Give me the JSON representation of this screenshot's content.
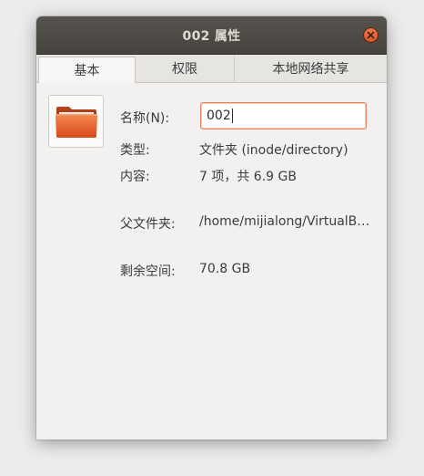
{
  "window": {
    "title": "002 属性",
    "close_icon": "close-icon"
  },
  "tabs": [
    {
      "label": "基本",
      "active": true
    },
    {
      "label": "权限",
      "active": false
    },
    {
      "label": "本地网络共享",
      "active": false
    }
  ],
  "basic": {
    "icon": "folder-icon",
    "name_label": "名称(N):",
    "name_value": "002",
    "type_label": "类型:",
    "type_value": "文件夹 (inode/directory)",
    "contents_label": "内容:",
    "contents_value": "7 项，共 6.9 GB",
    "parent_label": "父文件夹:",
    "parent_value": "/home/mijialong/VirtualB…",
    "free_label": "剩余空间:",
    "free_value": "70.8 GB"
  },
  "colors": {
    "accent": "#e95420",
    "titlebar": "#4c4944"
  }
}
